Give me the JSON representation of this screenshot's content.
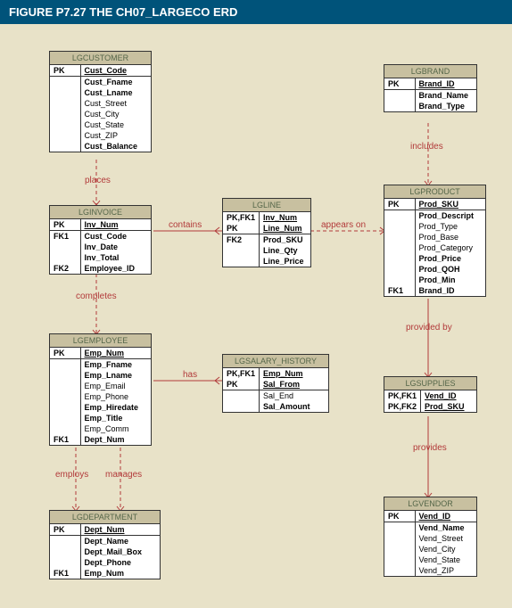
{
  "title": "FIGURE P7.27  THE CH07_LARGECO ERD",
  "relationships": {
    "places": "places",
    "contains": "contains",
    "appears_on": "appears on",
    "includes": "includes",
    "completes": "completes",
    "has": "has",
    "employs": "employs",
    "manages": "manages",
    "provided_by": "provided by",
    "provides": "provides"
  },
  "entities": {
    "lgcustomer": {
      "name": "LGCUSTOMER",
      "pk_row": {
        "key": "PK",
        "attr": "Cust_Code"
      },
      "attrs": [
        {
          "key": "",
          "attr": "Cust_Fname",
          "bold": true
        },
        {
          "key": "",
          "attr": "Cust_Lname",
          "bold": true
        },
        {
          "key": "",
          "attr": "Cust_Street"
        },
        {
          "key": "",
          "attr": "Cust_City"
        },
        {
          "key": "",
          "attr": "Cust_State"
        },
        {
          "key": "",
          "attr": "Cust_ZIP"
        },
        {
          "key": "",
          "attr": "Cust_Balance",
          "bold": true
        }
      ]
    },
    "lgbrand": {
      "name": "LGBRAND",
      "pk_row": {
        "key": "PK",
        "attr": "Brand_ID"
      },
      "attrs": [
        {
          "key": "",
          "attr": "Brand_Name",
          "bold": true
        },
        {
          "key": "",
          "attr": "Brand_Type",
          "bold": true
        }
      ]
    },
    "lginvoice": {
      "name": "LGINVOICE",
      "pk_row": {
        "key": "PK",
        "attr": "Inv_Num"
      },
      "attrs": [
        {
          "key": "FK1",
          "attr": "Cust_Code",
          "bold": true
        },
        {
          "key": "",
          "attr": "Inv_Date",
          "bold": true
        },
        {
          "key": "",
          "attr": "Inv_Total",
          "bold": true
        },
        {
          "key": "FK2",
          "attr": "Employee_ID",
          "bold": true
        }
      ]
    },
    "lgline": {
      "name": "LGLINE",
      "pk_rows": [
        {
          "key": "PK,FK1",
          "attr": "Inv_Num"
        },
        {
          "key": "PK",
          "attr": "Line_Num"
        }
      ],
      "attrs": [
        {
          "key": "FK2",
          "attr": "Prod_SKU",
          "bold": true
        },
        {
          "key": "",
          "attr": "Line_Qty",
          "bold": true
        },
        {
          "key": "",
          "attr": "Line_Price",
          "bold": true
        }
      ]
    },
    "lgproduct": {
      "name": "LGPRODUCT",
      "pk_row": {
        "key": "PK",
        "attr": "Prod_SKU"
      },
      "attrs": [
        {
          "key": "",
          "attr": "Prod_Descript",
          "bold": true
        },
        {
          "key": "",
          "attr": "Prod_Type"
        },
        {
          "key": "",
          "attr": "Prod_Base"
        },
        {
          "key": "",
          "attr": "Prod_Category"
        },
        {
          "key": "",
          "attr": "Prod_Price",
          "bold": true
        },
        {
          "key": "",
          "attr": "Prod_QOH",
          "bold": true
        },
        {
          "key": "",
          "attr": "Prod_Min",
          "bold": true
        },
        {
          "key": "FK1",
          "attr": "Brand_ID",
          "bold": true
        }
      ]
    },
    "lgemployee": {
      "name": "LGEMPLOYEE",
      "pk_row": {
        "key": "PK",
        "attr": "Emp_Num"
      },
      "attrs": [
        {
          "key": "",
          "attr": "Emp_Fname",
          "bold": true
        },
        {
          "key": "",
          "attr": "Emp_Lname",
          "bold": true
        },
        {
          "key": "",
          "attr": "Emp_Email"
        },
        {
          "key": "",
          "attr": "Emp_Phone"
        },
        {
          "key": "",
          "attr": "Emp_Hiredate",
          "bold": true
        },
        {
          "key": "",
          "attr": "Emp_Title",
          "bold": true
        },
        {
          "key": "",
          "attr": "Emp_Comm"
        },
        {
          "key": "FK1",
          "attr": "Dept_Num",
          "bold": true
        }
      ]
    },
    "lgsalary": {
      "name": "LGSALARY_HISTORY",
      "pk_rows": [
        {
          "key": "PK,FK1",
          "attr": "Emp_Num"
        },
        {
          "key": "PK",
          "attr": "Sal_From"
        }
      ],
      "attrs": [
        {
          "key": "",
          "attr": "Sal_End"
        },
        {
          "key": "",
          "attr": "Sal_Amount",
          "bold": true
        }
      ]
    },
    "lgsupplies": {
      "name": "LGSUPPLIES",
      "pk_rows": [
        {
          "key": "PK,FK1",
          "attr": "Vend_ID"
        },
        {
          "key": "PK,FK2",
          "attr": "Prod_SKU"
        }
      ],
      "attrs": []
    },
    "lgdepartment": {
      "name": "LGDEPARTMENT",
      "pk_row": {
        "key": "PK",
        "attr": "Dept_Num"
      },
      "attrs": [
        {
          "key": "",
          "attr": "Dept_Name",
          "bold": true
        },
        {
          "key": "",
          "attr": "Dept_Mail_Box",
          "bold": true
        },
        {
          "key": "",
          "attr": "Dept_Phone",
          "bold": true
        },
        {
          "key": "FK1",
          "attr": "Emp_Num",
          "bold": true
        }
      ]
    },
    "lgvendor": {
      "name": "LGVENDOR",
      "pk_row": {
        "key": "PK",
        "attr": "Vend_ID"
      },
      "attrs": [
        {
          "key": "",
          "attr": "Vend_Name",
          "bold": true
        },
        {
          "key": "",
          "attr": "Vend_Street"
        },
        {
          "key": "",
          "attr": "Vend_City"
        },
        {
          "key": "",
          "attr": "Vend_State"
        },
        {
          "key": "",
          "attr": "Vend_ZIP"
        }
      ]
    }
  }
}
